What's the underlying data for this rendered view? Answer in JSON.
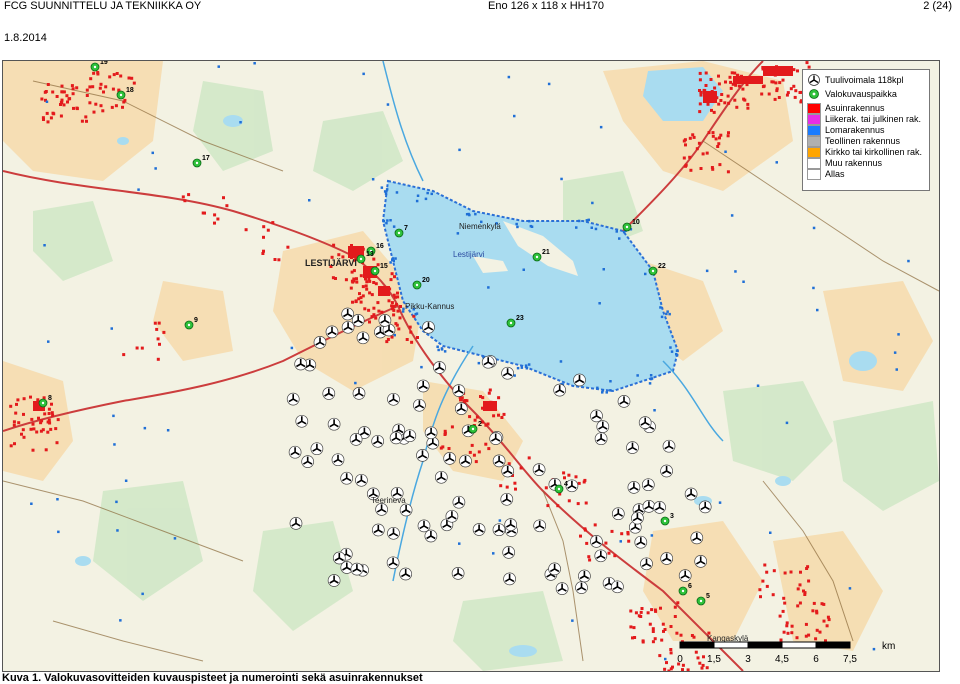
{
  "header": {
    "left": "FCG SUUNNITTELU JA TEKNIIKKA OY",
    "center": "Eno 126 x 118 x HH170",
    "right": "2 (24)"
  },
  "date": "1.8.2014",
  "map": {
    "place_labels": {
      "town": "LESTIJÄRVI",
      "lake": "Lestijärvi",
      "niemenkyla": "Niemenkylä",
      "teerineva": "Teerineva",
      "pikku_kannus": "Pikku-Kannus",
      "kangaskyla": "Kangaskylä"
    },
    "photo_points": [
      "19",
      "18",
      "17",
      "16",
      "13",
      "15",
      "20",
      "9",
      "8",
      "2",
      "10",
      "21",
      "22",
      "23",
      "4",
      "3",
      "5",
      "6",
      "7"
    ],
    "colors": {
      "water": "#a9dcf0",
      "forest": "#f1f1df",
      "field": "#f7d9a6",
      "bog": "#c9e3c2",
      "road": "#cc3d3d",
      "house": "#e31a1c",
      "holiday": "#1f6fd6",
      "photo": "#2ec13a"
    }
  },
  "legend": {
    "items": [
      {
        "label": "Tuulivoimala 118kpl",
        "icon": "wind-turbine-icon"
      },
      {
        "label": "Valokuvauspaikka",
        "icon": "photo-point-icon"
      },
      {
        "label": "Asuinrakennus",
        "color": "#ff0000"
      },
      {
        "label": "Liikerak. tai julkinen rak.",
        "color": "#e62ee6"
      },
      {
        "label": "Lomarakennus",
        "color": "#1a7cff"
      },
      {
        "label": "Teollinen rakennus",
        "color": "#b0b0b0"
      },
      {
        "label": "Kirkko tai kirkollinen rak.",
        "color": "#ffa500"
      },
      {
        "label": "Muu rakennus",
        "color": "#ffffff"
      },
      {
        "label": "Allas",
        "color": "#ffffff"
      }
    ]
  },
  "scale": {
    "ticks": [
      "0",
      "1,5",
      "3",
      "4,5",
      "6",
      "7,5"
    ],
    "unit": "km"
  },
  "caption": "Kuva 1. Valokuvasovitteiden kuvauspisteet ja numerointi sekä asuinrakennukset"
}
